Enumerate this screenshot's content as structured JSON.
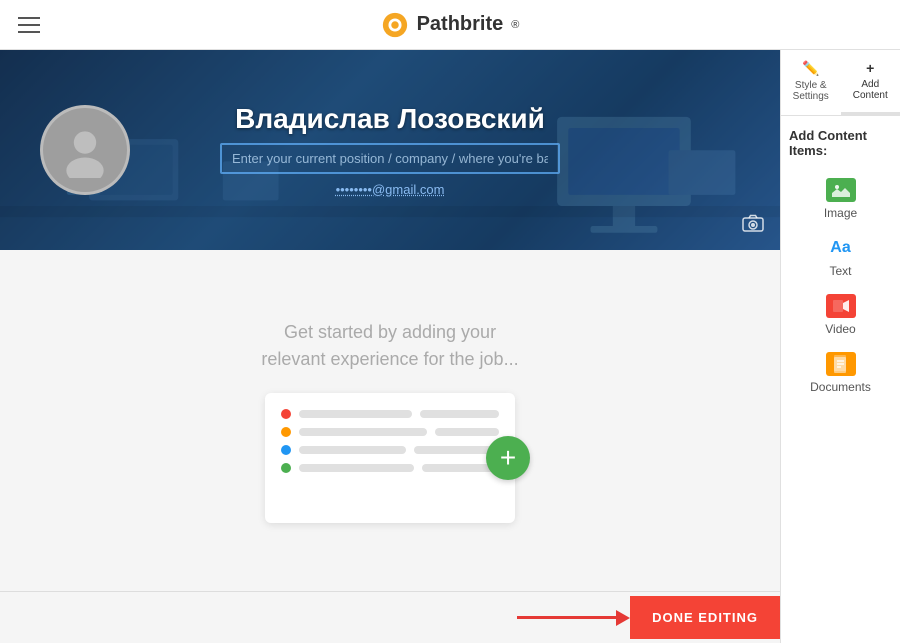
{
  "header": {
    "logo_text": "Pathbrite",
    "logo_reg": "®"
  },
  "hero": {
    "name": "Владислав Лозовский",
    "position_placeholder": "Enter your current position / company / where you're based",
    "email_display": "••••••••@gmail.com"
  },
  "body": {
    "get_started_line1": "Get started by adding your",
    "get_started_line2": "relevant experience for the job..."
  },
  "sidebar": {
    "tab_style_label": "Style & Settings",
    "tab_add_label": "Add Content",
    "section_title": "Add Content Items:",
    "items": [
      {
        "id": "image",
        "label": "Image"
      },
      {
        "id": "text",
        "label": "Text"
      },
      {
        "id": "video",
        "label": "Video"
      },
      {
        "id": "documents",
        "label": "Documents"
      }
    ]
  },
  "done_editing": {
    "label": "DONE EDITING"
  },
  "card_dots": [
    {
      "color": "#f44336"
    },
    {
      "color": "#ff9800"
    },
    {
      "color": "#2196f3"
    },
    {
      "color": "#4caf50"
    }
  ]
}
